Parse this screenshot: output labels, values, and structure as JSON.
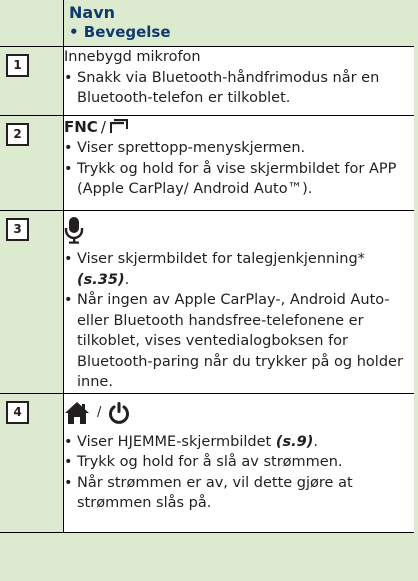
{
  "header": {
    "title": "Navn",
    "subtitle": "• Bevegelse"
  },
  "rows": [
    {
      "number": "1",
      "title": "Innebygd mikrofon",
      "bullets": [
        "Snakk via Bluetooth-håndfrimodus når en Bluetooth-telefon er tilkoblet."
      ]
    },
    {
      "number": "2",
      "title": "FNC",
      "title_separator": "/",
      "title_icon": "menu-window-icon",
      "bullets": [
        "Viser sprettopp-menyskjermen.",
        "Trykk og hold for å vise skjermbildet for APP (Apple CarPlay/ Android Auto™)."
      ]
    },
    {
      "number": "3",
      "title_icon": "microphone-icon",
      "bullet1_text": "Viser skjermbildet for talegjenkjenning*",
      "bullet1_ref": "(s.35)",
      "bullet1_after": ".",
      "bullet2_text": "Når ingen av Apple CarPlay-, Android Auto- eller Bluetooth handsfree-telefonene er tilkoblet, vises ventedialogboksen for Bluetooth-paring når du trykker på og holder inne."
    },
    {
      "number": "4",
      "title_icon": "home-icon",
      "title_separator": "/",
      "title_icon2": "power-icon",
      "bullet1_text": "Viser HJEMME-skjermbildet",
      "bullet1_ref": "(s.9)",
      "bullet1_after": ".",
      "bullet2_text": "Trykk og hold for å slå av strømmen.",
      "bullet3_text": "Når strømmen er av, vil dette gjøre at strømmen slås på."
    }
  ],
  "colors": {
    "header_bg": "#dcebd0",
    "header_text": "#103a6e",
    "text": "#231f20"
  }
}
